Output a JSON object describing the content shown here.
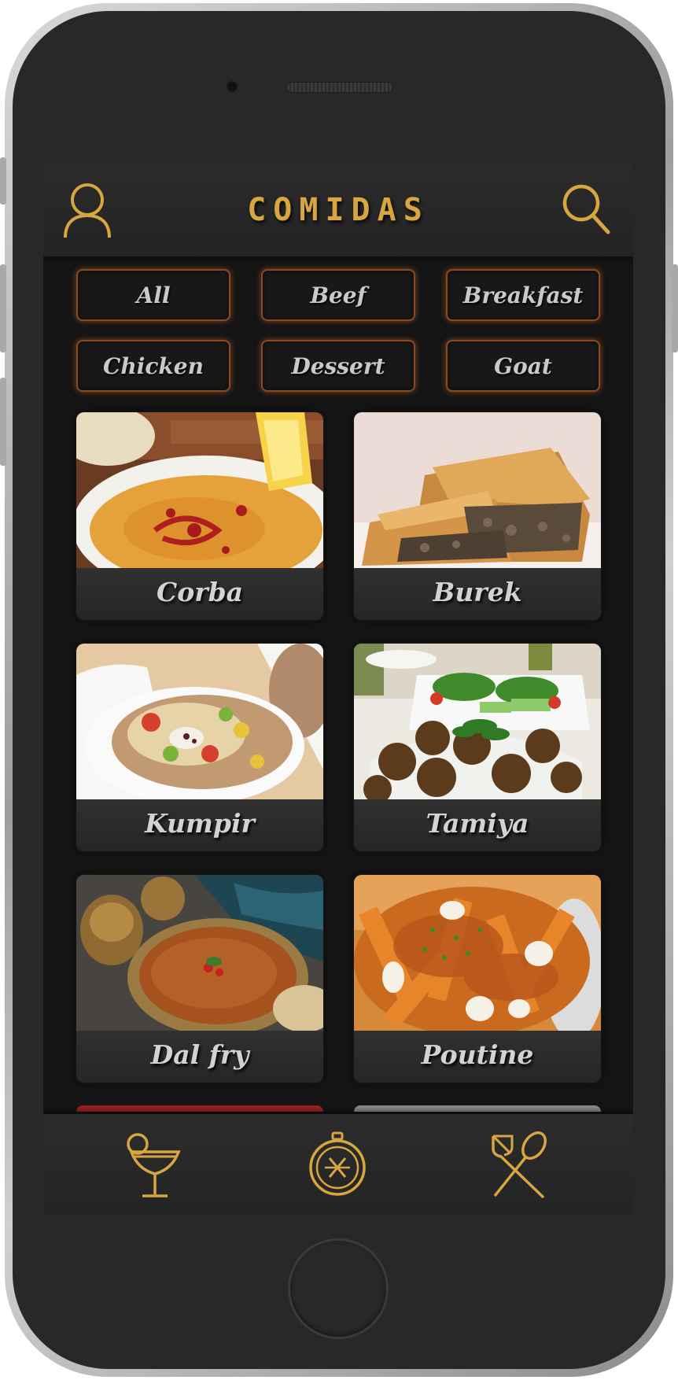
{
  "app": {
    "title": "COMIDAS",
    "accent_color": "#d7a640",
    "chip_border_color": "#8a4b22"
  },
  "header": {
    "left_icon": "profile-icon",
    "right_icon": "search-icon"
  },
  "filters": [
    {
      "label": "All"
    },
    {
      "label": "Beef"
    },
    {
      "label": "Breakfast"
    },
    {
      "label": "Chicken"
    },
    {
      "label": "Dessert"
    },
    {
      "label": "Goat"
    }
  ],
  "meals": [
    {
      "name": "Corba"
    },
    {
      "name": "Burek"
    },
    {
      "name": "Kumpir"
    },
    {
      "name": "Tamiya"
    },
    {
      "name": "Dal fry"
    },
    {
      "name": "Poutine"
    }
  ],
  "tabbar": [
    {
      "icon": "cocktail-icon"
    },
    {
      "icon": "compass-icon"
    },
    {
      "icon": "fork-spoon-icon"
    }
  ]
}
